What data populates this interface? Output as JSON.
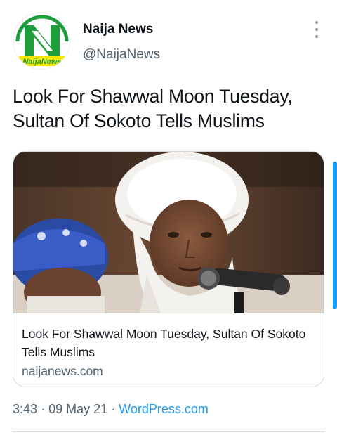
{
  "author": {
    "name": "Naija News",
    "handle": "@NaijaNews",
    "avatar_icon": "naija-news-logo",
    "avatar_logo_text": "NaijaNews",
    "brand_color": "#1f9e3c"
  },
  "tweet": {
    "text": "Look For Shawwal Moon Tuesday, Sultan Of Sokoto Tells Muslims"
  },
  "card": {
    "title": "Look For Shawwal Moon Tuesday, Sultan Of Sokoto Tells Muslims",
    "domain": "naijanews.com"
  },
  "meta": {
    "time": "3:43",
    "separator": "·",
    "date": "09 May 21",
    "source": "WordPress.com"
  },
  "colors": {
    "link": "#1d9bf0",
    "secondary_text": "#536471",
    "border": "#cfd9de"
  }
}
